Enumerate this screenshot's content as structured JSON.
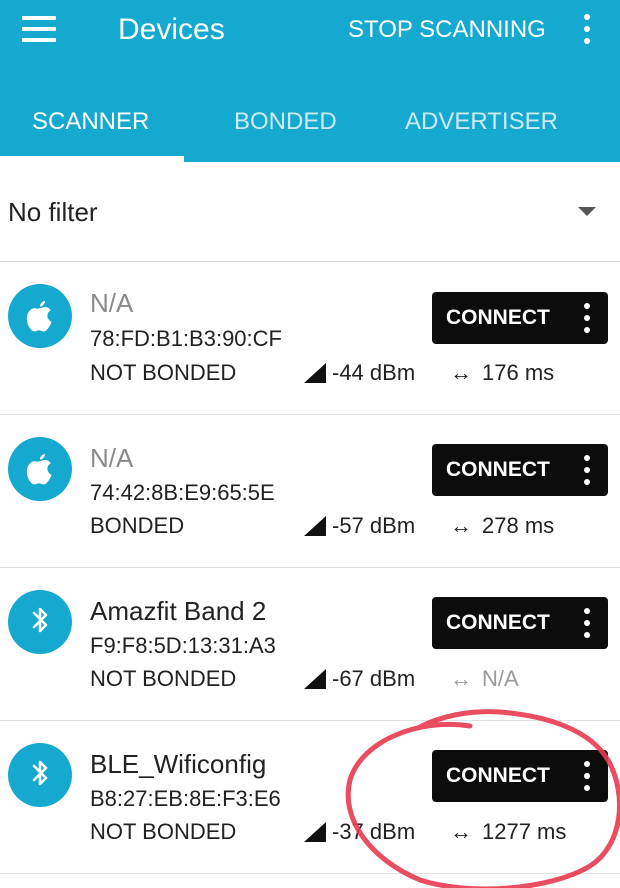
{
  "app": {
    "title": "Devices",
    "stop_scanning_label": "STOP SCANNING",
    "menu_icon": "menu-icon",
    "overflow_icon": "more-vert-icon",
    "accent_color": "#16a9cf"
  },
  "tabs": [
    {
      "label": "SCANNER",
      "active": true
    },
    {
      "label": "BONDED",
      "active": false
    },
    {
      "label": "ADVERTISER",
      "active": false
    }
  ],
  "filter": {
    "label": "No filter"
  },
  "devices": [
    {
      "name": "N/A",
      "address": "78:FD:B1:B3:90:CF",
      "bond_state": "NOT BONDED",
      "rssi": "-44 dBm",
      "interval": "176 ms",
      "icon": "apple-icon",
      "connect_label": "CONNECT"
    },
    {
      "name": "N/A",
      "address": "74:42:8B:E9:65:5E",
      "bond_state": "BONDED",
      "rssi": "-57 dBm",
      "interval": "278 ms",
      "icon": "apple-icon",
      "connect_label": "CONNECT"
    },
    {
      "name": "Amazfit Band 2",
      "address": "F9:F8:5D:13:31:A3",
      "bond_state": "NOT BONDED",
      "rssi": "-67 dBm",
      "interval": "N/A",
      "icon": "bluetooth-icon",
      "connect_label": "CONNECT"
    },
    {
      "name": "BLE_Wificonfig",
      "address": "B8:27:EB:8E:F3:E6",
      "bond_state": "NOT BONDED",
      "rssi": "-37 dBm",
      "interval": "1277 ms",
      "icon": "bluetooth-icon",
      "connect_label": "CONNECT"
    }
  ],
  "annotation": {
    "type": "hand-drawn circle",
    "color": "#e8384f"
  }
}
